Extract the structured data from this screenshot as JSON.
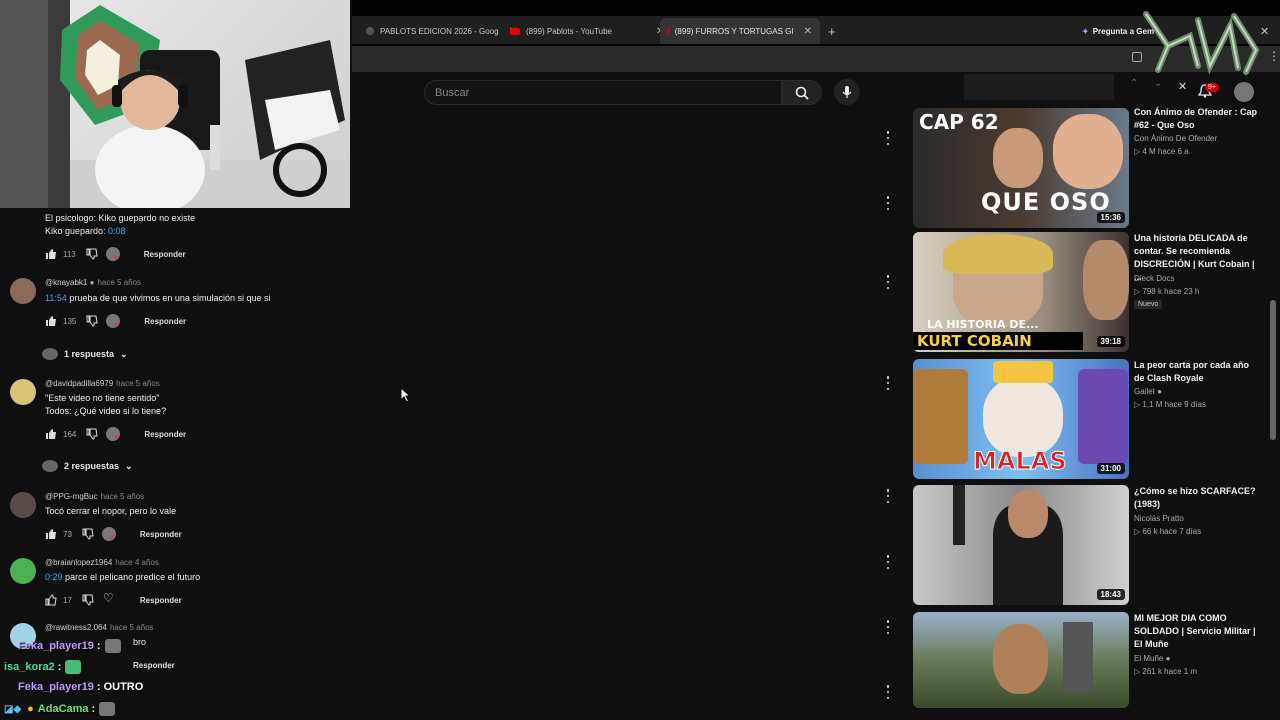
{
  "browser": {
    "tabs": [
      {
        "title": "PABLOTS EDICION 2026 - Goog",
        "icon": "google-icon"
      },
      {
        "title": "(899) Pablots - YouTube",
        "icon": "youtube-icon"
      },
      {
        "title": "(899) FURROS Y TORTUGAS GI",
        "icon": "youtube-icon",
        "active": true
      }
    ],
    "gemini_label": "Pregunta a Gem",
    "notif_badge": "9+"
  },
  "search": {
    "placeholder": "Buscar"
  },
  "comments": [
    {
      "handle": "",
      "when": "",
      "line1": "El psicologo: Kiko guepardo no existe",
      "line2_prefix": "Kiko guepardo: ",
      "line2_ts": "0:08",
      "likes": "113",
      "reply": "Responder"
    },
    {
      "handle": "@knayabk1",
      "when": "hace 5 años",
      "ts": "11:54",
      "text": " prueba de que vivimos en una simulación si que si",
      "likes": "135",
      "reply": "Responder",
      "replies_label": "1 respuesta"
    },
    {
      "handle": "@davidpadilla6979",
      "when": "hace 5 años",
      "line1": "\"Este video no tiene sentido\"",
      "line2": "Todos: ¿Qué video si lo tiene?",
      "likes": "164",
      "reply": "Responder",
      "replies_label": "2 respuestas"
    },
    {
      "handle": "@PPG-mgBuc",
      "when": "hace 5 años",
      "text": "Tocó cerrar el nopor, pero lo vale",
      "likes": "73",
      "reply": "Responder"
    },
    {
      "handle": "@braianlopez1964",
      "when": "hace 4 años",
      "ts": "0:29",
      "text": " parce el pelicano predice el futuro",
      "likes": "17",
      "reply": "Responder"
    },
    {
      "handle": "@rawitness2.064",
      "when": "hace 5 años",
      "partial": "bro",
      "reply": "Responder"
    }
  ],
  "chat": [
    {
      "user": "Feka_player19",
      "msg": ":"
    },
    {
      "user": "isa_kora2",
      "msg": ":"
    },
    {
      "user": "Feka_player19",
      "msg": ": OUTRO"
    },
    {
      "user": "AdaCama",
      "msg": ":"
    }
  ],
  "recommended": [
    {
      "title": "Con Ánimo de Ofender : Cap #62 - Que Oso",
      "channel": "Con Ánimo De Ofender",
      "meta": "4 M  hace 6 a",
      "duration": "15:36",
      "thumb_text": [
        "CAP 62",
        "QUE OSO"
      ]
    },
    {
      "title": "Una historia DELICADA de contar. Se recomienda DISCRECIÓN | Kurt Cobain | ...",
      "channel": "Dieck Docs",
      "meta": "798 k  hace 23 h",
      "badge": "Nuevo",
      "duration": "39:18",
      "thumb_text": [
        "LA HISTORIA DE...",
        "KURT COBAIN"
      ]
    },
    {
      "title": "La peor carta por cada año de Clash Royale",
      "channel": "Gailet",
      "meta": "1,1 M  hace 9 días",
      "duration": "31:00",
      "thumb_text": [
        "MALAS"
      ]
    },
    {
      "title": "¿Cómo se hizo SCARFACE? (1983)",
      "channel": "Nicolás Pratto",
      "meta": "66 k  hace 7 días",
      "duration": "18:43",
      "thumb_text": []
    },
    {
      "title": "MI MEJOR DIA COMO SOLDADO | Servicio Militar | El Muñe",
      "channel": "El Muñe",
      "meta": "261 k  hace 1 m",
      "duration": "",
      "thumb_text": []
    }
  ],
  "colors": {
    "accent": "#3ea6ff",
    "youtube_red": "#ff0000",
    "background": "#0f0f0f"
  }
}
